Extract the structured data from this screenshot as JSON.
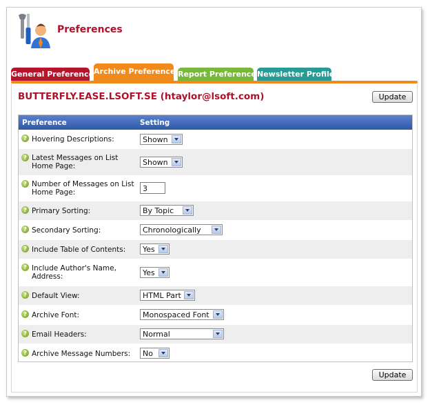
{
  "header": {
    "title": "Preferences",
    "icon": "preferences-tools-user-icon"
  },
  "tabs": [
    {
      "label": "General Preferences",
      "color": "#b3162c"
    },
    {
      "label": "Archive Preferences",
      "color": "#f08a1c",
      "active": true
    },
    {
      "label": "Report Preferences",
      "color": "#7ab83c"
    },
    {
      "label": "Newsletter Profile",
      "color": "#2a9a94"
    }
  ],
  "list_name": "BUTTERFLY.EASE.LSOFT.SE (htaylor@lsoft.com)",
  "update_label": "Update",
  "table": {
    "col_preference": "Preference",
    "col_setting": "Setting",
    "rows": [
      {
        "label": "Hovering Descriptions:",
        "value": "Shown"
      },
      {
        "label": "Latest Messages on List Home Page:",
        "value": "Shown"
      },
      {
        "label": "Number of Messages on List Home Page:",
        "value": "3"
      },
      {
        "label": "Primary Sorting:",
        "value": "By Topic"
      },
      {
        "label": "Secondary Sorting:",
        "value": "Chronologically"
      },
      {
        "label": "Include Table of Contents:",
        "value": "Yes"
      },
      {
        "label": "Include Author's Name, Address:",
        "value": "Yes"
      },
      {
        "label": "Default View:",
        "value": "HTML Part"
      },
      {
        "label": "Archive Font:",
        "value": "Monospaced Font"
      },
      {
        "label": "Email Headers:",
        "value": "Normal"
      },
      {
        "label": "Archive Message Numbers:",
        "value": "No"
      }
    ]
  }
}
